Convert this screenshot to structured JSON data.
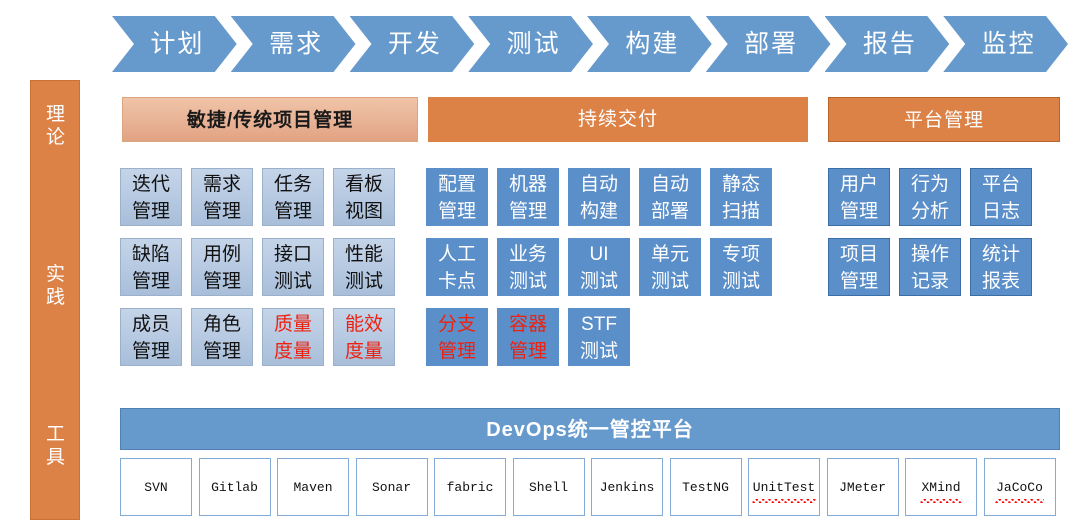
{
  "categories": [
    {
      "id": "theory",
      "label": "理\n论"
    },
    {
      "id": "practice",
      "label": "实\n践"
    },
    {
      "id": "tools",
      "label": "工\n具"
    }
  ],
  "stages": [
    {
      "label": "计划"
    },
    {
      "label": "需求"
    },
    {
      "label": "开发"
    },
    {
      "label": "测试"
    },
    {
      "label": "构建"
    },
    {
      "label": "部署"
    },
    {
      "label": "报告"
    },
    {
      "label": "监控"
    }
  ],
  "theory_bands": [
    {
      "label": "敏捷/传统项目管理",
      "style": "light"
    },
    {
      "label": "持续交付",
      "style": "orange"
    },
    {
      "label": "平台管理",
      "style": "orange-bordered"
    }
  ],
  "practice": {
    "rows": [
      {
        "cells": [
          {
            "label": "迭代\n管理",
            "group": "agile",
            "red": false
          },
          {
            "label": "需求\n管理",
            "group": "agile",
            "red": false
          },
          {
            "label": "任务\n管理",
            "group": "agile",
            "red": false
          },
          {
            "label": "看板\n视图",
            "group": "agile",
            "red": false
          },
          {
            "label": "配置\n管理",
            "group": "cd",
            "red": false
          },
          {
            "label": "机器\n管理",
            "group": "cd",
            "red": false
          },
          {
            "label": "自动\n构建",
            "group": "cd",
            "red": false
          },
          {
            "label": "自动\n部署",
            "group": "cd",
            "red": false
          },
          {
            "label": "静态\n扫描",
            "group": "cd",
            "red": false
          },
          {
            "label": "用户\n管理",
            "group": "platform",
            "red": false
          },
          {
            "label": "行为\n分析",
            "group": "platform",
            "red": false
          },
          {
            "label": "平台\n日志",
            "group": "platform",
            "red": false
          }
        ]
      },
      {
        "cells": [
          {
            "label": "缺陷\n管理",
            "group": "agile",
            "red": false
          },
          {
            "label": "用例\n管理",
            "group": "agile",
            "red": false
          },
          {
            "label": "接口\n测试",
            "group": "agile",
            "red": false
          },
          {
            "label": "性能\n测试",
            "group": "agile",
            "red": false
          },
          {
            "label": "人工\n卡点",
            "group": "cd",
            "red": false
          },
          {
            "label": "业务\n测试",
            "group": "cd",
            "red": false
          },
          {
            "label": "UI\n测试",
            "group": "cd",
            "red": false
          },
          {
            "label": "单元\n测试",
            "group": "cd",
            "red": false
          },
          {
            "label": "专项\n测试",
            "group": "cd",
            "red": false
          },
          {
            "label": "项目\n管理",
            "group": "platform",
            "red": false
          },
          {
            "label": "操作\n记录",
            "group": "platform",
            "red": false
          },
          {
            "label": "统计\n报表",
            "group": "platform",
            "red": false
          }
        ]
      },
      {
        "cells": [
          {
            "label": "成员\n管理",
            "group": "agile",
            "red": false
          },
          {
            "label": "角色\n管理",
            "group": "agile",
            "red": false
          },
          {
            "label": "质量\n度量",
            "group": "agile",
            "red": true
          },
          {
            "label": "能效\n度量",
            "group": "agile",
            "red": true
          },
          {
            "label": "分支\n管理",
            "group": "cd",
            "red": true
          },
          {
            "label": "容器\n管理",
            "group": "cd",
            "red": true
          },
          {
            "label": "STF\n测试",
            "group": "cd",
            "red": false
          }
        ]
      }
    ]
  },
  "platform_bar": {
    "label": "DevOps统一管控平台"
  },
  "tools": [
    {
      "label": "SVN",
      "misspelled": false
    },
    {
      "label": "Gitlab",
      "misspelled": false
    },
    {
      "label": "Maven",
      "misspelled": false
    },
    {
      "label": "Sonar",
      "misspelled": false
    },
    {
      "label": "fabric",
      "misspelled": false
    },
    {
      "label": "Shell",
      "misspelled": false
    },
    {
      "label": "Jenkins",
      "misspelled": false
    },
    {
      "label": "TestNG",
      "misspelled": false
    },
    {
      "label": "UnitTest",
      "misspelled": true
    },
    {
      "label": "JMeter",
      "misspelled": false
    },
    {
      "label": "XMind",
      "misspelled": true
    },
    {
      "label": "JaCoCo",
      "misspelled": true
    }
  ],
  "colors": {
    "stage_blue": "#6699cc",
    "band_orange": "#dd8247",
    "band_light": "#e8b295",
    "cell_light_blue": "#b9cbe3",
    "cell_blue": "#5b8fc9",
    "red_text": "#ee2211",
    "tool_border": "#84aad6"
  }
}
